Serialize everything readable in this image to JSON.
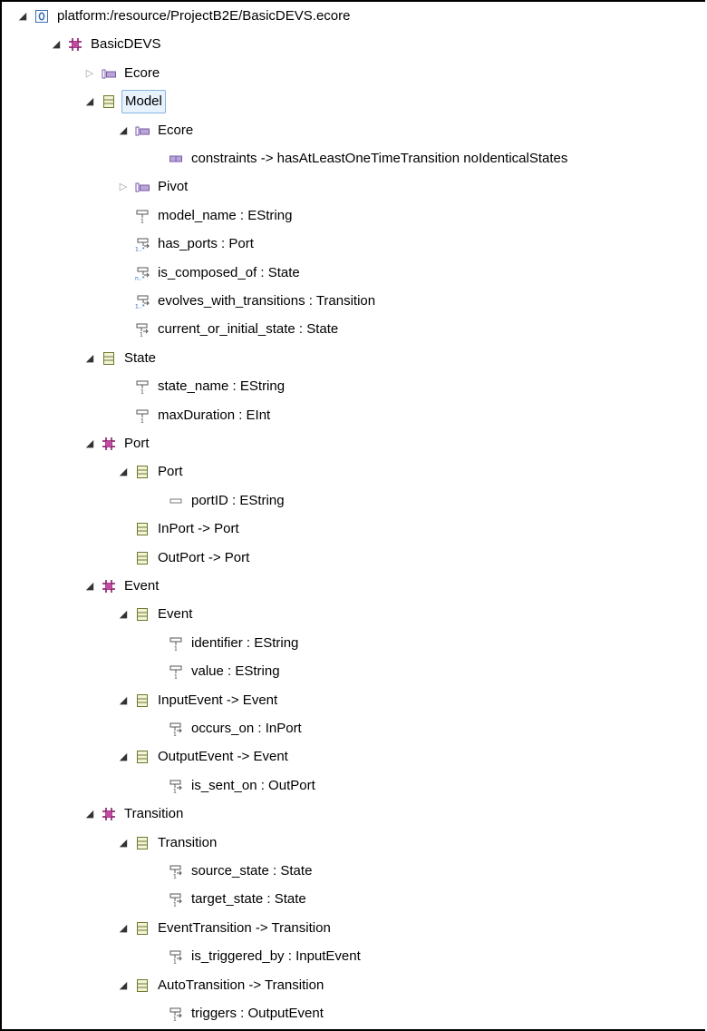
{
  "tree": {
    "nodes": [
      {
        "depth": 0,
        "toggle": "expanded",
        "icon": "resource-icon",
        "label": "platform:/resource/ProjectB2E/BasicDEVS.ecore"
      },
      {
        "depth": 1,
        "toggle": "expanded",
        "icon": "package-icon",
        "label": "BasicDEVS"
      },
      {
        "depth": 2,
        "toggle": "collapsed",
        "icon": "annotation-icon",
        "label": "Ecore"
      },
      {
        "depth": 2,
        "toggle": "expanded",
        "icon": "class-icon",
        "label": "Model",
        "selected": true
      },
      {
        "depth": 3,
        "toggle": "expanded",
        "icon": "annotation-icon",
        "label": "Ecore"
      },
      {
        "depth": 4,
        "toggle": "none",
        "icon": "details-entry-icon",
        "label": "constraints -> hasAtLeastOneTimeTransition noIdenticalStates"
      },
      {
        "depth": 3,
        "toggle": "collapsed",
        "icon": "annotation-icon",
        "label": "Pivot"
      },
      {
        "depth": 3,
        "toggle": "none",
        "icon": "attribute-icon",
        "label": "model_name : EString"
      },
      {
        "depth": 3,
        "toggle": "none",
        "icon": "reference-many-icon",
        "label": "has_ports : Port"
      },
      {
        "depth": 3,
        "toggle": "none",
        "icon": "reference-many-n-icon",
        "label": "is_composed_of : State"
      },
      {
        "depth": 3,
        "toggle": "none",
        "icon": "reference-many-icon",
        "label": "evolves_with_transitions : Transition"
      },
      {
        "depth": 3,
        "toggle": "none",
        "icon": "reference-icon",
        "label": "current_or_initial_state : State"
      },
      {
        "depth": 2,
        "toggle": "expanded",
        "icon": "class-icon",
        "label": "State"
      },
      {
        "depth": 3,
        "toggle": "none",
        "icon": "attribute-icon",
        "label": "state_name : EString"
      },
      {
        "depth": 3,
        "toggle": "none",
        "icon": "attribute-icon",
        "label": "maxDuration : EInt"
      },
      {
        "depth": 2,
        "toggle": "expanded",
        "icon": "package-icon",
        "label": "Port"
      },
      {
        "depth": 3,
        "toggle": "expanded",
        "icon": "class-icon",
        "label": "Port"
      },
      {
        "depth": 4,
        "toggle": "none",
        "icon": "attribute-optional-icon",
        "label": "portID : EString"
      },
      {
        "depth": 3,
        "toggle": "none",
        "icon": "class-icon",
        "label": "InPort -> Port"
      },
      {
        "depth": 3,
        "toggle": "none",
        "icon": "class-icon",
        "label": "OutPort -> Port"
      },
      {
        "depth": 2,
        "toggle": "expanded",
        "icon": "package-icon",
        "label": "Event"
      },
      {
        "depth": 3,
        "toggle": "expanded",
        "icon": "class-icon",
        "label": "Event"
      },
      {
        "depth": 4,
        "toggle": "none",
        "icon": "attribute-icon",
        "label": "identifier : EString"
      },
      {
        "depth": 4,
        "toggle": "none",
        "icon": "attribute-icon",
        "label": "value : EString"
      },
      {
        "depth": 3,
        "toggle": "expanded",
        "icon": "class-icon",
        "label": "InputEvent -> Event"
      },
      {
        "depth": 4,
        "toggle": "none",
        "icon": "reference-icon",
        "label": "occurs_on : InPort"
      },
      {
        "depth": 3,
        "toggle": "expanded",
        "icon": "class-icon",
        "label": "OutputEvent -> Event"
      },
      {
        "depth": 4,
        "toggle": "none",
        "icon": "reference-icon",
        "label": "is_sent_on : OutPort"
      },
      {
        "depth": 2,
        "toggle": "expanded",
        "icon": "package-icon",
        "label": "Transition"
      },
      {
        "depth": 3,
        "toggle": "expanded",
        "icon": "class-icon",
        "label": "Transition"
      },
      {
        "depth": 4,
        "toggle": "none",
        "icon": "reference-icon",
        "label": "source_state : State"
      },
      {
        "depth": 4,
        "toggle": "none",
        "icon": "reference-icon",
        "label": "target_state : State"
      },
      {
        "depth": 3,
        "toggle": "expanded",
        "icon": "class-icon",
        "label": "EventTransition -> Transition"
      },
      {
        "depth": 4,
        "toggle": "none",
        "icon": "reference-icon",
        "label": "is_triggered_by : InputEvent"
      },
      {
        "depth": 3,
        "toggle": "expanded",
        "icon": "class-icon",
        "label": "AutoTransition -> Transition"
      },
      {
        "depth": 4,
        "toggle": "none",
        "icon": "reference-icon",
        "label": "triggers : OutputEvent"
      }
    ]
  },
  "colors": {
    "package": "#8b1a6b",
    "class": "#6b7a2a",
    "annotation": "#7a5aa8",
    "reference": "#555555",
    "selection_border": "#86b4e0"
  }
}
